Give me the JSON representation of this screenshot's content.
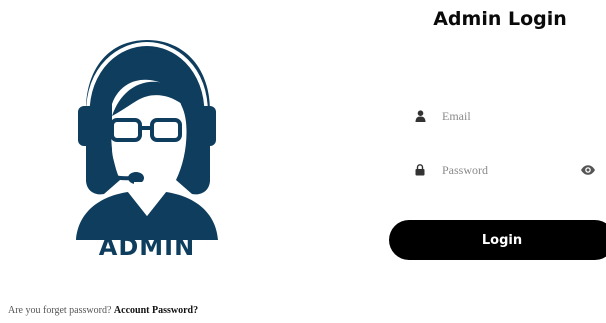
{
  "avatar": {
    "caption": "ADMIN",
    "icon": "admin-headset-avatar",
    "color": "#0f3d5e"
  },
  "login": {
    "title": "Admin Login",
    "email": {
      "placeholder": "Email",
      "value": "",
      "icon": "user-icon"
    },
    "password": {
      "placeholder": "Password",
      "value": "",
      "icon": "lock-icon",
      "toggle_icon": "eye-icon"
    },
    "button_label": "Login",
    "button_color": "#000000"
  },
  "footer": {
    "prompt": "Are you forget password?",
    "link": "Account Password?"
  }
}
